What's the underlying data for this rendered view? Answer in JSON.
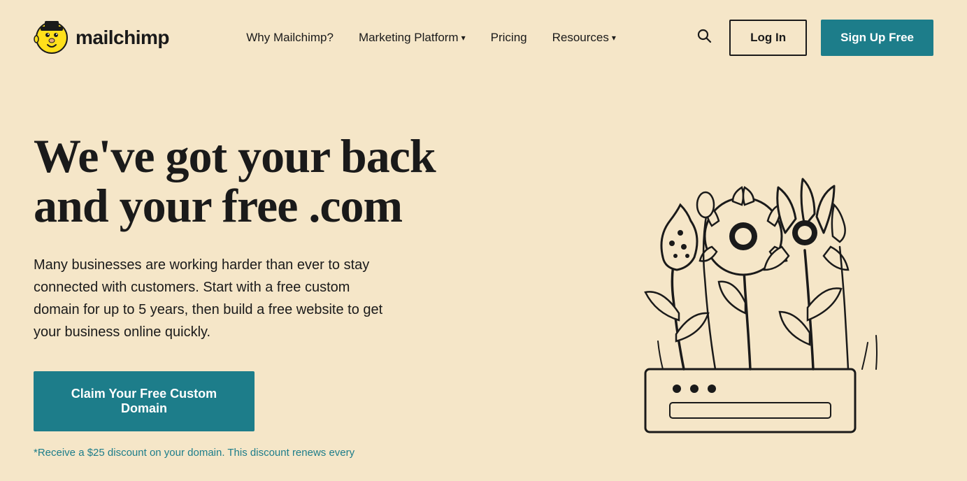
{
  "logo": {
    "text": "mailchimp",
    "alt": "Mailchimp"
  },
  "nav": {
    "items": [
      {
        "label": "Why Mailchimp?",
        "hasDropdown": false
      },
      {
        "label": "Marketing Platform",
        "hasDropdown": true
      },
      {
        "label": "Pricing",
        "hasDropdown": false
      },
      {
        "label": "Resources",
        "hasDropdown": true
      }
    ]
  },
  "header": {
    "search_aria": "Search",
    "login_label": "Log In",
    "signup_label": "Sign Up Free"
  },
  "hero": {
    "title": "We've got your back and your free .com",
    "description": "Many businesses are working harder than ever to stay connected with customers. Start with a free custom domain for up to 5 years, then build a free website to get your business online quickly.",
    "cta_label": "Claim Your Free Custom Domain",
    "disclaimer": "*Receive a $25 discount on your domain. This discount renews every"
  },
  "colors": {
    "background": "#f5e6c8",
    "teal": "#1d7d8a",
    "dark": "#1a1a1a",
    "white": "#ffffff"
  }
}
